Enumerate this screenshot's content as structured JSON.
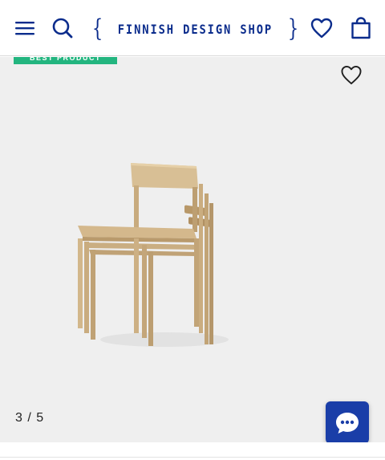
{
  "header": {
    "logo_text": "FINNISH DESIGN SHOP",
    "brand_color": "#0b2c8c",
    "icons": [
      "menu-icon",
      "search-icon",
      "heart-icon",
      "shopping-bag-icon"
    ]
  },
  "gallery": {
    "badge_label": "BEST PRODUCT",
    "badge_color": "#23b57f",
    "background": "#efefef",
    "image_subject": "stacked-wooden-chairs",
    "counter": "3 / 5",
    "current_index": 3,
    "total_images": 5
  },
  "chat": {
    "icon": "chat-bubble-icon",
    "color": "#1a3ea8"
  }
}
